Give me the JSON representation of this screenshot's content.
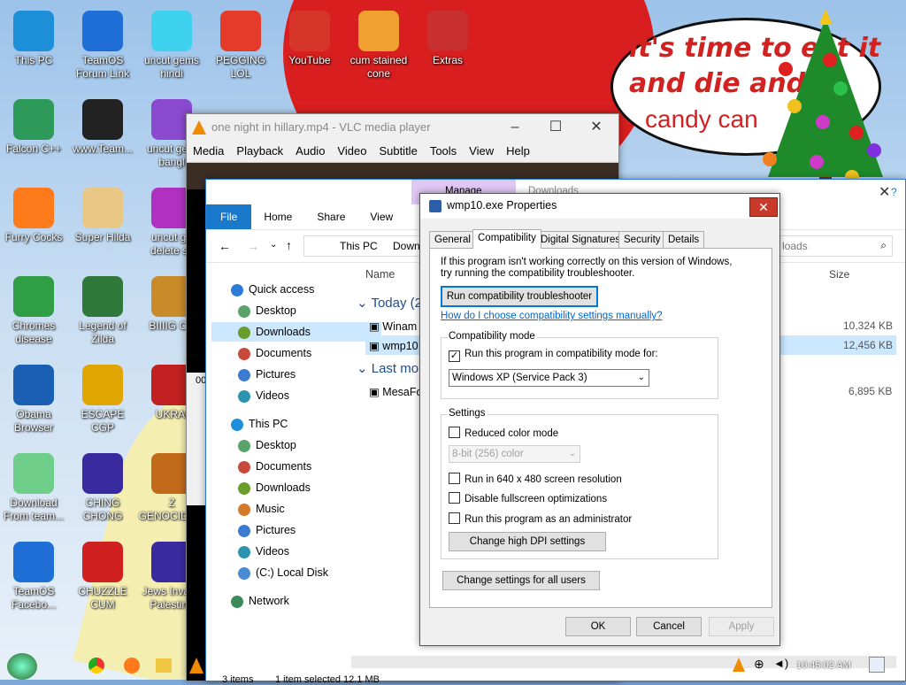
{
  "desktop": {
    "bubble": {
      "line1": "it's time to eat it",
      "line2": "and die and c",
      "line3": "candy can"
    },
    "icons": [
      {
        "label": "This PC",
        "color": "#1d8fd8"
      },
      {
        "label": "TeamOS Forum Link",
        "color": "#1f6fd6"
      },
      {
        "label": "uncut gems hindi",
        "color": "#3fd1f0"
      },
      {
        "label": "PEGGING LOL",
        "color": "#e53b2a"
      },
      {
        "label": "YouTube",
        "color": "#d6352a"
      },
      {
        "label": "cum stained cone",
        "color": "#f0a030"
      },
      {
        "label": "Extras",
        "color": "#c83030"
      },
      {
        "label": "Falcon C++",
        "color": "#2e9a5a"
      },
      {
        "label": "www.Team...",
        "color": "#222222"
      },
      {
        "label": "uncut gem bangl",
        "color": "#8a4ad0"
      },
      {
        "label": "Furry Cocks",
        "color": "#ff7a1a"
      },
      {
        "label": "Super Hilda",
        "color": "#e9c784"
      },
      {
        "label": "uncut ge delete sc",
        "color": "#b030c0"
      },
      {
        "label": "Chromes disease",
        "color": "#2f9e44"
      },
      {
        "label": "Legend of Zilda",
        "color": "#2f7a3a"
      },
      {
        "label": "BIIIIG CU",
        "color": "#c98a2a"
      },
      {
        "label": "Obama Browser",
        "color": "#1a5fb4"
      },
      {
        "label": "ESCAPE CGP",
        "color": "#e0a500"
      },
      {
        "label": "UKRAI",
        "color": "#c02020"
      },
      {
        "label": "Download From team...",
        "color": "#6fcf8a"
      },
      {
        "label": "CHING CHONG",
        "color": "#3a2aa0"
      },
      {
        "label": "Z GENOCIDIST",
        "color": "#c06a1a"
      },
      {
        "label": "TeamOS Facebo...",
        "color": "#1f6fd6"
      },
      {
        "label": "CHUZZLE CUM",
        "color": "#d02020"
      },
      {
        "label": "Jews Invade Palestine",
        "color": "#3a2aa0"
      }
    ]
  },
  "vlc": {
    "title": "one night in hillary.mp4 - VLC media player",
    "menu": [
      "Media",
      "Playback",
      "Audio",
      "Video",
      "Subtitle",
      "Tools",
      "View",
      "Help"
    ],
    "time": "00"
  },
  "explorer": {
    "tab_manage": "Manage",
    "tab_downloads": "Downloads",
    "ribbon": [
      "File",
      "Home",
      "Share",
      "View"
    ],
    "path": [
      "This PC",
      "Down"
    ],
    "search_placeholder": "loads",
    "col_name": "Name",
    "col_size": "Size",
    "groups": [
      {
        "label": "Today (2",
        "rows": [
          {
            "name": "Winam",
            "size": "10,324 KB"
          },
          {
            "name": "wmp10",
            "size": "12,456 KB"
          }
        ]
      },
      {
        "label": "Last mor",
        "rows": [
          {
            "name": "MesaFo",
            "size": "6,895 KB"
          }
        ]
      }
    ],
    "nav": {
      "quick_access": "Quick access",
      "quick": [
        "Desktop",
        "Downloads",
        "Documents",
        "Pictures",
        "Videos"
      ],
      "this_pc": "This PC",
      "pc": [
        "Desktop",
        "Documents",
        "Downloads",
        "Music",
        "Pictures",
        "Videos",
        "(C:) Local Disk"
      ],
      "network": "Network"
    },
    "status": {
      "items": "3 items",
      "selected": "1 item selected  12.1 MB"
    }
  },
  "dialog": {
    "title": "wmp10.exe Properties",
    "tabs": [
      "General",
      "Compatibility",
      "Digital Signatures",
      "Security",
      "Details"
    ],
    "intro_line1": "If this program isn't working correctly on this version of Windows,",
    "intro_line2": "try running the compatibility troubleshooter.",
    "troubleshoot_btn": "Run compatibility troubleshooter",
    "help_link": "How do I choose compatibility settings manually?",
    "compat_group": "Compatibility mode",
    "compat_check": "Run this program in compatibility mode for:",
    "compat_value": "Windows XP (Service Pack 3)",
    "settings_group": "Settings",
    "reduced_color": "Reduced color mode",
    "color_value": "8-bit (256) color",
    "res_640": "Run in 640 x 480 screen resolution",
    "disable_fs": "Disable fullscreen optimizations",
    "run_admin": "Run this program as an administrator",
    "dpi_btn": "Change high DPI settings",
    "all_users_btn": "Change settings for all users",
    "ok": "OK",
    "cancel": "Cancel",
    "apply": "Apply"
  },
  "taskbar": {
    "clock": "10:45:02 AM"
  }
}
